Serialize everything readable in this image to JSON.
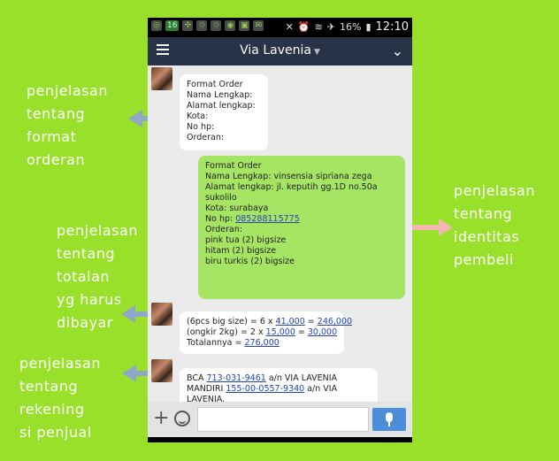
{
  "colors": {
    "background": "#99e02a",
    "arrow_blue": "#8fa8c8",
    "arrow_pink": "#f2b7b0",
    "bubble_me": "#a6e463",
    "appbar": "#283347"
  },
  "annotations": {
    "format": [
      "penjelasan",
      "tentang",
      "format",
      "orderan"
    ],
    "identitas": [
      "penjelasan",
      "tentang",
      "identitas",
      "pembeli"
    ],
    "totalan": [
      "penjelasan",
      "tentang",
      "totalan",
      "yg harus",
      "dibayar"
    ],
    "rekening": [
      "penjelasan",
      "tentang",
      "rekening",
      "si penjual"
    ]
  },
  "status_bar": {
    "badge": "16",
    "battery": "16%",
    "time": "12:10"
  },
  "app_bar": {
    "title": "Via Lavenia"
  },
  "messages": {
    "format_template": [
      "Format Order",
      "Nama Lengkap:",
      "Alamat lengkap:",
      "Kota:",
      "No hp:",
      "Orderan:"
    ],
    "buyer": {
      "l1": "Format Order",
      "l2": "Nama Lengkap: vinsensia sipriana zega",
      "l3": "Alamat lengkap: jl. keputih gg.1D no.50a",
      "l4": "sukolilo",
      "l5": "Kota: surabaya",
      "l6_prefix": "No hp: ",
      "l6_phone": "085288115775",
      "l7": "Orderan:",
      "l8": "pink tua (2) bigsize",
      "l9": "hitam (2) bigsize",
      "l10": "biru turkis (2) bigsize"
    },
    "total": {
      "a1": "(6pcs big size) = 6 x ",
      "a2": "41,000",
      "a3": " = ",
      "a4": "246,000",
      "b1": "(ongkir 2kg) = 2 x ",
      "b2": "15,000",
      "b3": " = ",
      "b4": "30,000",
      "c1": "Totalannya = ",
      "c2": "276,000"
    },
    "bank": {
      "a1": "BCA ",
      "a2": "713-031-9461",
      "a3": " a/n VIA LAVENIA",
      "b1": "MANDIRI ",
      "b2": "155-00-0557-9340",
      "b3": " a/n VIA",
      "c1": "LAVENIA."
    }
  }
}
